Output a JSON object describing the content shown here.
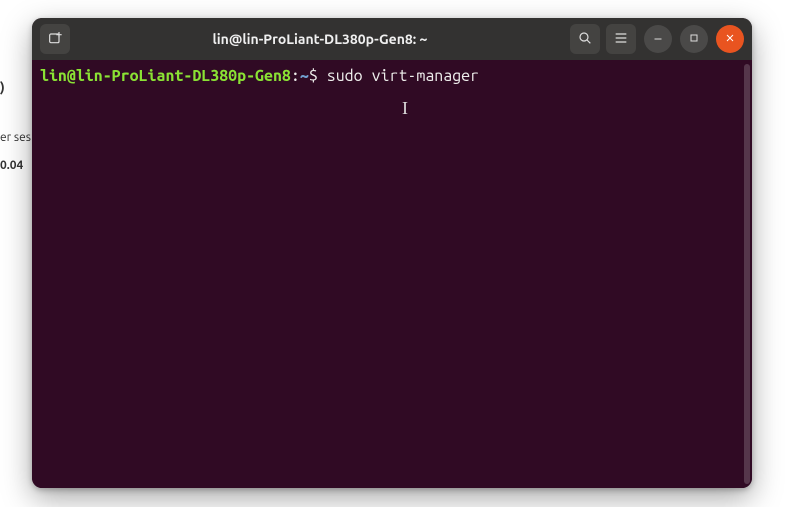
{
  "background": {
    "frag1": ")",
    "frag2": "er ses",
    "frag3": "0.04"
  },
  "titlebar": {
    "title": "lin@lin-ProLiant-DL380p-Gen8: ~",
    "icons": {
      "newtab": "new-tab-icon",
      "search": "search-icon",
      "menu": "hamburger-icon",
      "minimize": "minimize-icon",
      "maximize": "maximize-icon",
      "close": "close-icon"
    }
  },
  "terminal": {
    "prompt": {
      "user_host": "lin@lin-ProLiant-DL380p-Gen8",
      "separator": ":",
      "path": "~",
      "symbol": "$"
    },
    "command": "sudo virt-manager"
  }
}
